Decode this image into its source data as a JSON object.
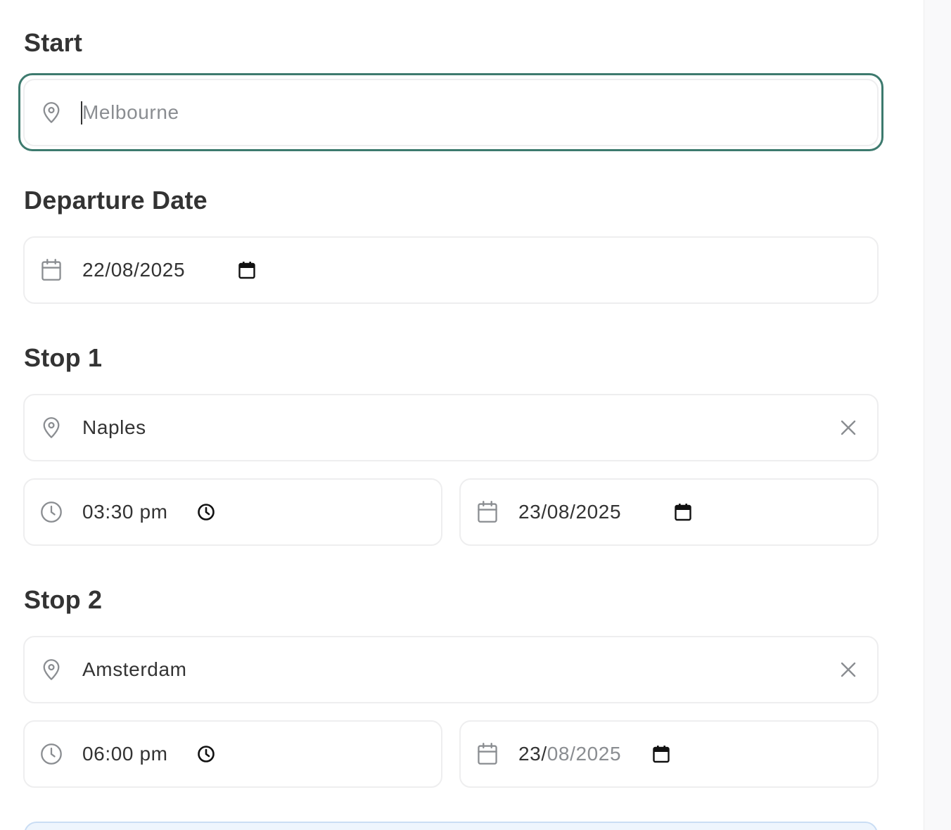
{
  "start": {
    "label": "Start",
    "placeholder": "Melbourne",
    "icon": "map-pin-icon"
  },
  "departure": {
    "label": "Departure Date",
    "date": "22/08/2025",
    "icon": "calendar-icon"
  },
  "stops": [
    {
      "label": "Stop 1",
      "location": "Naples",
      "time": "03:30 pm",
      "date": "23/08/2025"
    },
    {
      "label": "Stop 2",
      "location": "Amsterdam",
      "time": "06:00 pm",
      "date_day": "23/",
      "date_rest": "08/2025"
    }
  ],
  "colors": {
    "focus": "#3d7a6e",
    "border": "#eeeeef",
    "text": "#333333",
    "icon": "#8a8d91",
    "info_bg": "#eef5fd"
  }
}
